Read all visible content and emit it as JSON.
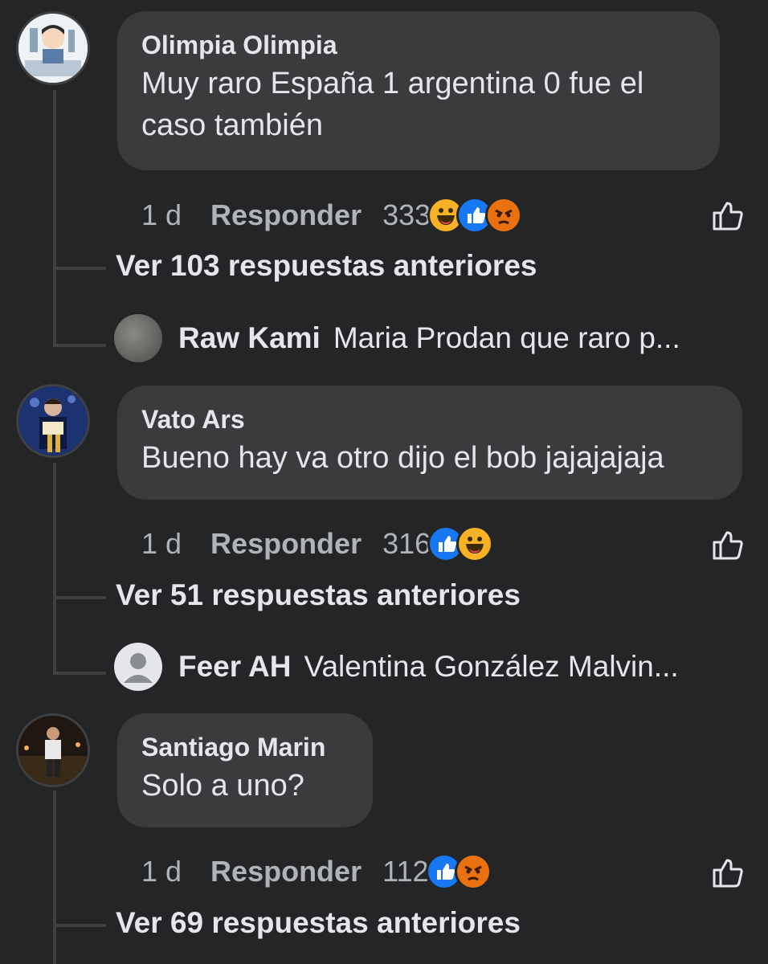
{
  "comments": [
    {
      "author": "Olimpia Olimpia",
      "text_line1": "Muy raro España 1 argentina 0 fue el",
      "text_line2": "caso también",
      "time": "1 d",
      "reply_label": "Responder",
      "reaction_count": "333",
      "reactions": [
        "haha",
        "like",
        "angry"
      ],
      "more_replies": "Ver 103 respuestas anteriores",
      "last_reply": {
        "author": "Raw Kami",
        "text": "Maria Prodan que raro p..."
      }
    },
    {
      "author": "Vato Ars",
      "text_line1": "Bueno hay va otro dijo el bob jajajajaja",
      "time": "1 d",
      "reply_label": "Responder",
      "reaction_count": "316",
      "reactions": [
        "like",
        "haha"
      ],
      "more_replies": "Ver 51 respuestas anteriores",
      "last_reply": {
        "author": "Feer AH",
        "text": "Valentina González Malvin..."
      }
    },
    {
      "author": "Santiago Marin",
      "text_line1": "Solo a uno?",
      "time": "1 d",
      "reply_label": "Responder",
      "reaction_count": "112",
      "reactions": [
        "like",
        "angry"
      ],
      "more_replies": "Ver 69 respuestas anteriores"
    }
  ],
  "colors": {
    "background": "#242526",
    "bubble": "#3a3b3c",
    "like_blue": "#1877f2",
    "haha_yellow": "#f7b125",
    "angry_orange": "#e9710f"
  },
  "icons": [
    "thumbs-up-outline-icon",
    "like-reaction-icon",
    "haha-reaction-icon",
    "angry-reaction-icon",
    "default-avatar-icon"
  ]
}
